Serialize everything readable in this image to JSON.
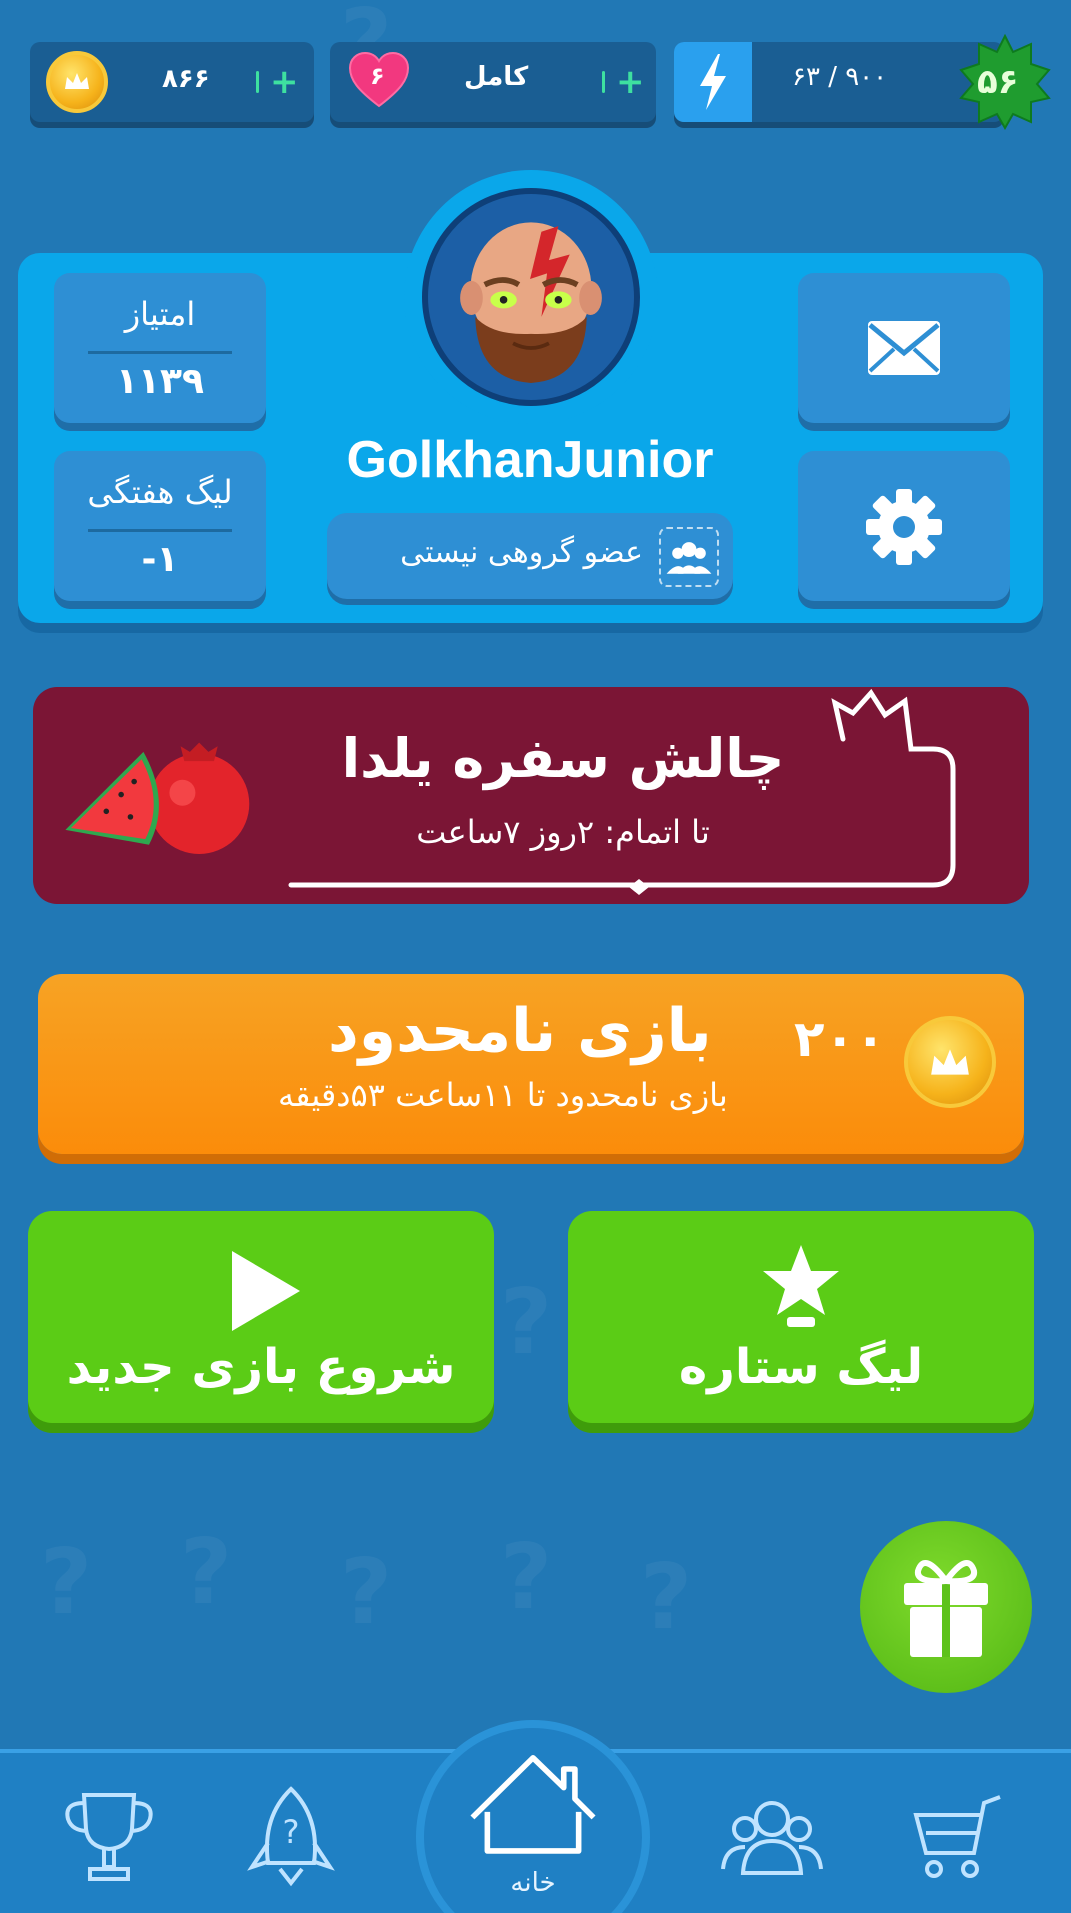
{
  "topbar": {
    "coins": "۸۶۶",
    "lives_status": "کامل",
    "lives_count": "۶",
    "energy": "۶۳ / ۹۰۰",
    "level": "۵۶"
  },
  "profile": {
    "score_label": "امتیاز",
    "score_value": "۱۱۳۹",
    "weekly_label": "لیگ هفتگی",
    "weekly_value": "-۱",
    "username": "GolkhanJunior",
    "group_status": "عضو گروهی نیستی"
  },
  "yalda": {
    "title": "چالش سفره یلدا",
    "subtitle": "تا اتمام: ۲روز ۷ساعت"
  },
  "unlimited": {
    "title": "بازی نامحدود",
    "subtitle": "بازی نامحدود تا ۱۱ساعت ۵۳دقیقه",
    "cost": "۲۰۰"
  },
  "actions": {
    "star_league": "لیگ ستاره",
    "new_game": "شروع بازی جدید"
  },
  "nav": {
    "home_label": "خانه",
    "items": [
      "trophy-icon",
      "rocket-question-icon",
      "home-icon",
      "friends-icon",
      "cart-icon"
    ]
  },
  "colors": {
    "background": "#2178b5",
    "card": "#0aa7ea",
    "yalda_banner": "#7b1535",
    "unlimited_orange": "#fb8c0a",
    "green_button": "#5bcc16"
  }
}
